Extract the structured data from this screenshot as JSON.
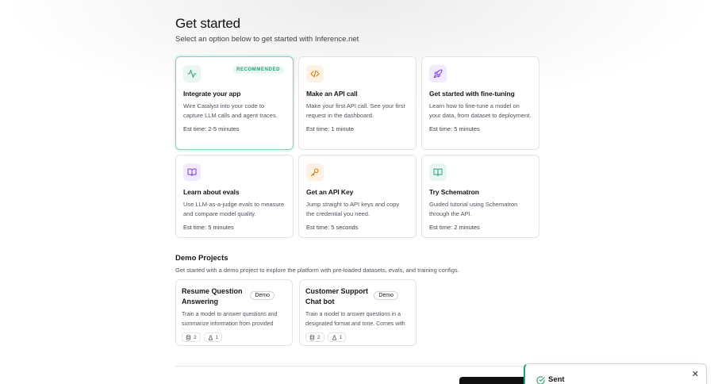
{
  "header": {
    "title": "Get started",
    "subtitle": "Select an option below to get started with Inference.net"
  },
  "options": [
    {
      "title": "Integrate your app",
      "desc": "Wire Catalyst into your code to capture LLM calls and agent traces.",
      "est": "Est time: 2-5 minutes",
      "badge": "RECOMMENDED",
      "icon": "activity-icon",
      "icon_color": "#2a9d80",
      "icon_bg": "#e8f7f2"
    },
    {
      "title": "Make an API call",
      "desc": "Make your first API call. See your first request in the dashboard.",
      "est": "Est time: 1 minute",
      "icon": "code-icon",
      "icon_color": "#d97706",
      "icon_bg": "#fdf1e3"
    },
    {
      "title": "Get started with fine-tuning",
      "desc": "Learn how to fine-tune a model on your data, from dataset to deployment.",
      "est": "Est time: 5 minutes",
      "icon": "rocket-icon",
      "icon_color": "#7c3aed",
      "icon_bg": "#f1ebfd"
    },
    {
      "title": "Learn about evals",
      "desc": "Use LLM-as-a-judge evals to measure and compare model quality.",
      "est": "Est time: 5 minutes",
      "icon": "book-icon",
      "icon_color": "#7c3aed",
      "icon_bg": "#f1ebfd"
    },
    {
      "title": "Get an API Key",
      "desc": "Jump straight to API keys and copy the credential you need.",
      "est": "Est time: 5 seconds",
      "icon": "key-icon",
      "icon_color": "#d97706",
      "icon_bg": "#fdf1e3"
    },
    {
      "title": "Try Schematron",
      "desc": "Guided tutorial using Schematron through the API.",
      "est": "Est time: 2 minutes",
      "icon": "book-open-icon",
      "icon_color": "#2a9d80",
      "icon_bg": "#e8f7f2"
    }
  ],
  "demo": {
    "title": "Demo Projects",
    "subtitle": "Get started with a demo project to explore the platform with pre-loaded datasets, evals, and training configs.",
    "projects": [
      {
        "title": "Resume Question Answering",
        "badge": "Demo",
        "desc": "Train a model to answer questions and summarize information from provided resumes.",
        "datasets": "2",
        "users": "1"
      },
      {
        "title": "Customer Support Chat bot",
        "badge": "Demo",
        "desc": "Train a model to answer questions in a designated format and tone. Comes with sample data.",
        "datasets": "2",
        "users": "1"
      }
    ]
  },
  "toast": {
    "text": "Sent",
    "icon": "check-circle-icon",
    "close_icon": "close-icon"
  }
}
